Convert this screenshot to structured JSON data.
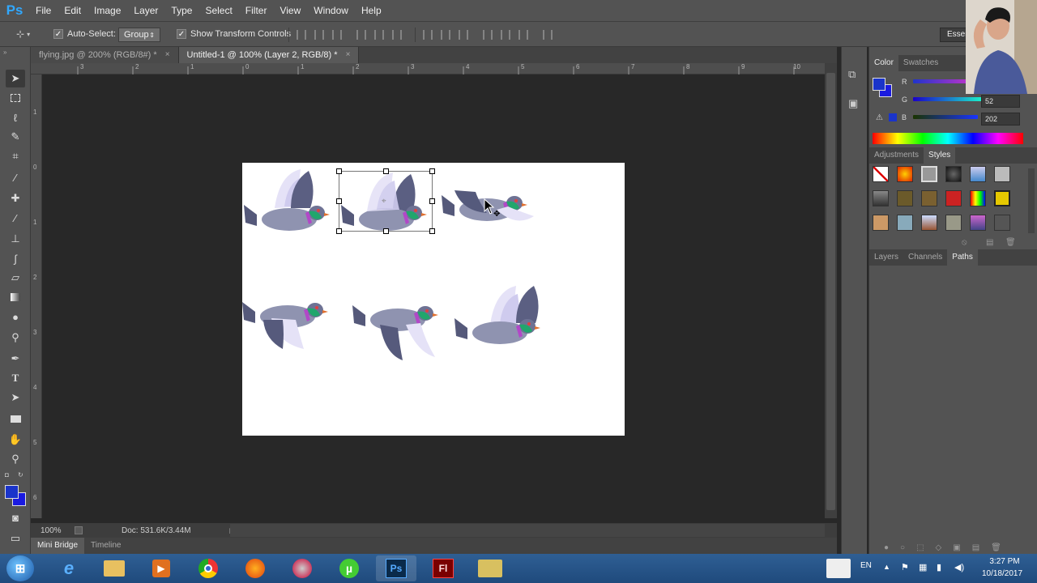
{
  "app": {
    "logo": "Ps",
    "menus": [
      "File",
      "Edit",
      "Image",
      "Layer",
      "Type",
      "Select",
      "Filter",
      "View",
      "Window",
      "Help"
    ]
  },
  "options": {
    "auto_select_label": "Auto-Select:",
    "auto_select_value": "Group",
    "show_transform_label": "Show Transform Controls",
    "workspace_label": "Essen"
  },
  "doc_tabs": [
    {
      "title": "flying.jpg @ 200% (RGB/8#) *",
      "close": "×"
    },
    {
      "title": "Untitled-1 @ 100% (Layer 2, RGB/8) *",
      "close": "×"
    }
  ],
  "rulers": {
    "h": [
      "3",
      "2",
      "1",
      "0",
      "1",
      "2",
      "3",
      "4",
      "5",
      "6",
      "7",
      "8",
      "9",
      "10"
    ],
    "v": [
      "1",
      "0",
      "1",
      "2",
      "3",
      "4",
      "5",
      "6"
    ]
  },
  "status": {
    "zoom": "100%",
    "doc": "Doc: 531.6K/3.44M"
  },
  "bottom_tabs": [
    "Mini Bridge",
    "Timeline"
  ],
  "color_panel": {
    "tabs": [
      "Color",
      "Swatches"
    ],
    "r_label": "R",
    "g_label": "G",
    "b_label": "B",
    "g_value": "52",
    "b_value": "202",
    "fg_color": "#1a34ca",
    "bg_color": "#1a1ae0"
  },
  "styles_panel": {
    "tabs": [
      "Adjustments",
      "Styles"
    ]
  },
  "layers_panel": {
    "tabs": [
      "Layers",
      "Channels",
      "Paths"
    ]
  },
  "taskbar": {
    "lang": "EN",
    "time": "3:27 PM",
    "date": "10/18/2017"
  }
}
